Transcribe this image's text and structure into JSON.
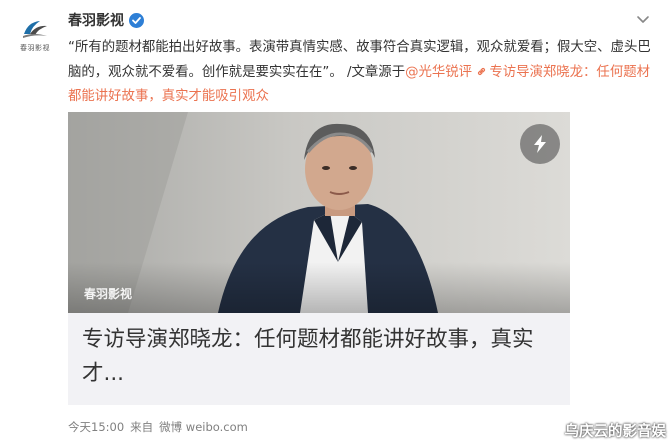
{
  "account": {
    "name": "春羽影视",
    "avatar_text": "春羽影视",
    "verified_icon": "verified-badge-icon",
    "accent": "#2e7fd6"
  },
  "post": {
    "text": "“所有的题材都能拍出好故事。表演带真情实感、故事符合真实逻辑，观众就爱看；假大空、虚头巴脑的，观众就不爱看。创作就是要实实在在”。 /文章源于",
    "mention": "@光华锐评",
    "link_icon": "link-icon",
    "link_text": "专访导演郑晓龙：任何题材都能讲好故事，真实才能吸引观众",
    "link_color": "#eb7350"
  },
  "card": {
    "image_watermark": "春羽影视",
    "flash_icon": "lightning-icon",
    "title": "专访导演郑晓龙：任何题材都能讲好故事，真实才..."
  },
  "footer": {
    "time": "今天15:00",
    "from": "来自",
    "source": "微博 weibo.com"
  },
  "corner_watermark": "乌庆云的影音娱"
}
